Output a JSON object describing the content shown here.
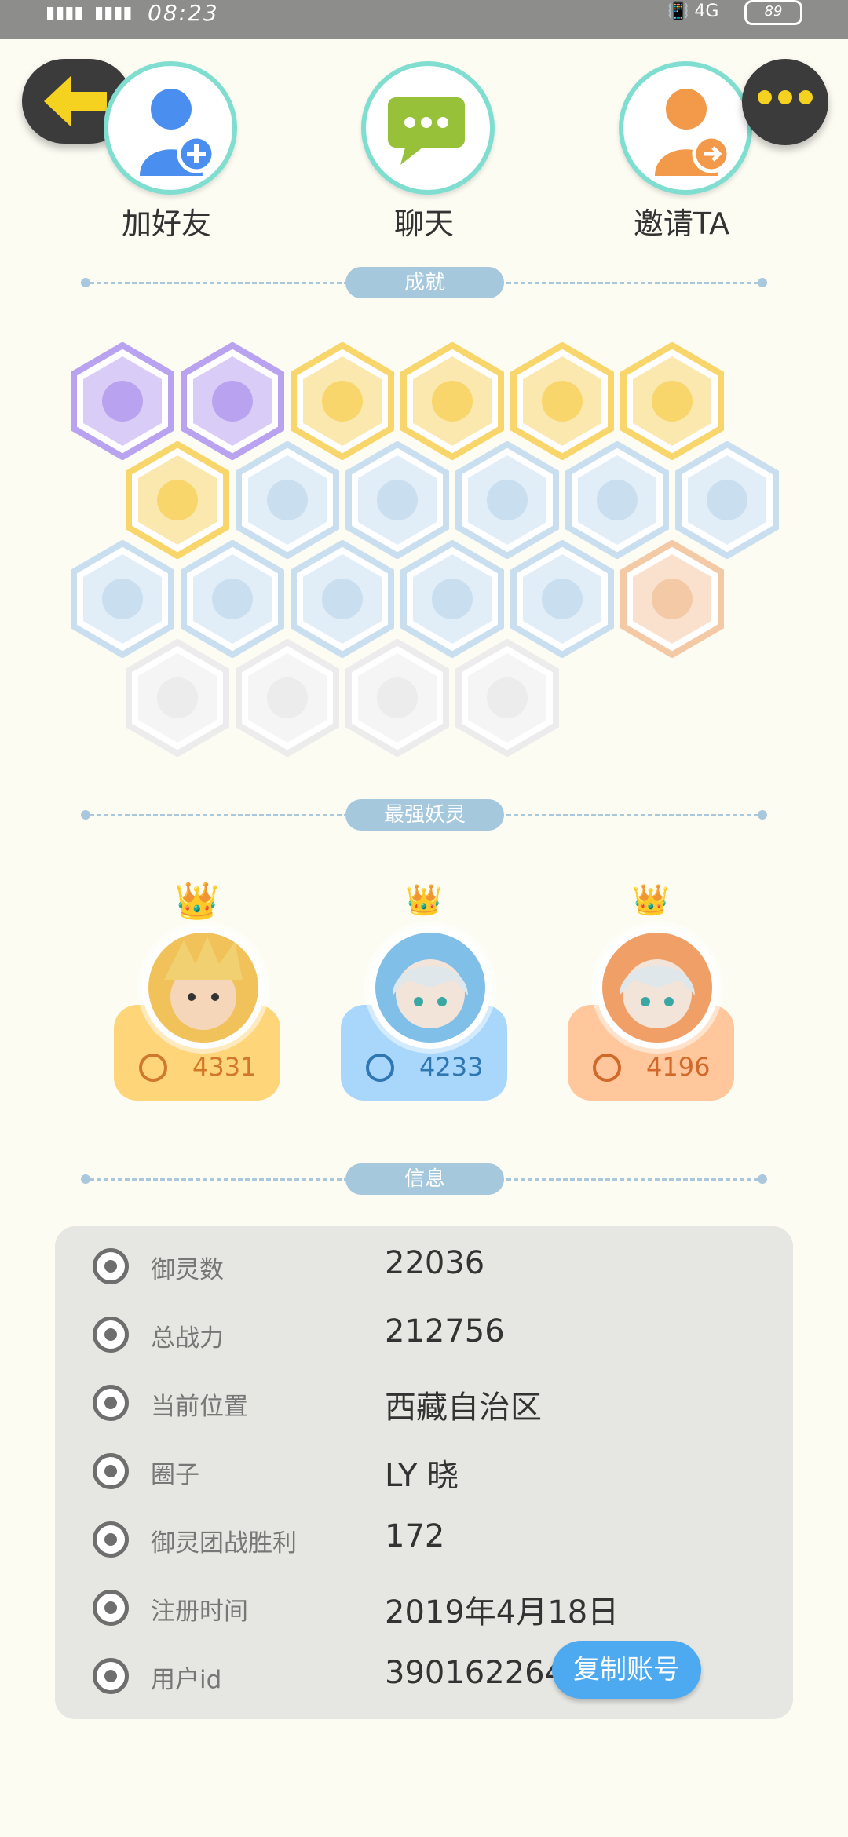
{
  "status_bar": {
    "time": "08:23",
    "battery": "89",
    "signal": "4G"
  },
  "actions": [
    {
      "label": "加好友"
    },
    {
      "label": "聊天"
    },
    {
      "label": "邀请TA"
    }
  ],
  "sections": {
    "achievements": "成就",
    "strongest": "最强妖灵",
    "info": "信息"
  },
  "achievement_colors": {
    "purple": "#b9a3f0",
    "gold": "#f8d66b",
    "blue": "#c9dff0",
    "orange": "#f4c9a6",
    "gray": "#ececec"
  },
  "heroes": [
    {
      "score": "4331",
      "tier": "gold",
      "color": "#ffd57a",
      "text_color": "#d1792a"
    },
    {
      "score": "4233",
      "tier": "blue",
      "color": "#a9d7fb",
      "text_color": "#2f77b3"
    },
    {
      "score": "4196",
      "tier": "orange",
      "color": "#ffc79b",
      "text_color": "#d1692a"
    }
  ],
  "info": {
    "rows": [
      {
        "icon": "spirit-icon",
        "key": "御灵数",
        "value": "22036"
      },
      {
        "icon": "sword-icon",
        "key": "总战力",
        "value": "212756"
      },
      {
        "icon": "location-icon",
        "key": "当前位置",
        "value": "西藏自治区"
      },
      {
        "icon": "circle-icon",
        "key": "圈子",
        "value": "LY 晓"
      },
      {
        "icon": "trophy-icon",
        "key": "御灵团战胜利",
        "value": "172"
      },
      {
        "icon": "clock-icon",
        "key": "注册时间",
        "value": "2019年4月18日"
      },
      {
        "icon": "id-icon",
        "key": "用户id",
        "value": "39016226442"
      }
    ],
    "copy_button": "复制账号"
  }
}
